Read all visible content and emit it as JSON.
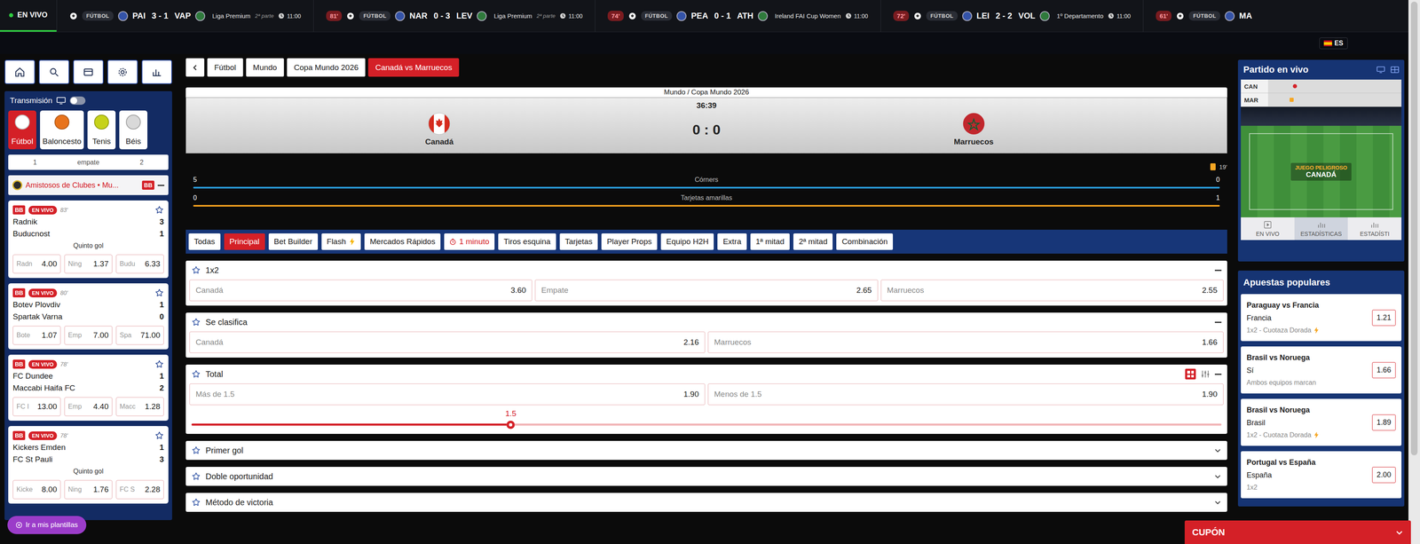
{
  "ticker": {
    "live_label": "EN VIVO",
    "matches": [
      {
        "sport": "FÚTBOL",
        "home": "PAI",
        "score": "3 - 1",
        "away": "VAP",
        "league": "Liga Premium",
        "period": "2ª parte",
        "time": "11:00"
      },
      {
        "minute": "81'",
        "sport": "FÚTBOL",
        "home": "NAR",
        "score": "0 - 3",
        "away": "LEV",
        "league": "Liga Premium",
        "period": "2ª parte",
        "time": "11:00"
      },
      {
        "minute": "74'",
        "sport": "FÚTBOL",
        "home": "PEA",
        "score": "0 - 1",
        "away": "ATH",
        "league": "Ireland FAI Cup Women",
        "time": "11:00"
      },
      {
        "minute": "72'",
        "sport": "FÚTBOL",
        "home": "LEI",
        "score": "2 - 2",
        "away": "VOL",
        "league": "1º Departamento",
        "time": "11:00"
      },
      {
        "minute": "61'",
        "sport": "FÚTBOL",
        "home": "MA"
      }
    ]
  },
  "language": {
    "code": "ES"
  },
  "sidebar": {
    "stream": {
      "label": "Transmisión",
      "on": false
    },
    "sports": [
      {
        "label": "Fútbol",
        "selected": true
      },
      {
        "label": "Baloncesto",
        "selected": false
      },
      {
        "label": "Tenis",
        "selected": false
      },
      {
        "label": "Béis",
        "selected": false
      }
    ],
    "columns": [
      "1",
      "empate",
      "2"
    ],
    "league": {
      "name": "Amistosos de Clubes • Mu...",
      "badge": "BB",
      "expanded": true
    },
    "matches": [
      {
        "badge": "BB",
        "status": "EN VIVO",
        "minute": "83'",
        "favorite": false,
        "teams": [
          {
            "name": "Radnik",
            "score": "3"
          },
          {
            "name": "Buducnost",
            "score": "1"
          }
        ],
        "market": "Quinto gol",
        "odds": [
          {
            "label": "Radn",
            "value": "4.00"
          },
          {
            "label": "Ning",
            "value": "1.37"
          },
          {
            "label": "Budu",
            "value": "6.33"
          }
        ]
      },
      {
        "badge": "BB",
        "status": "EN VIVO",
        "minute": "80'",
        "favorite": false,
        "teams": [
          {
            "name": "Botev Plovdiv",
            "score": "1"
          },
          {
            "name": "Spartak Varna",
            "score": "0"
          }
        ],
        "odds": [
          {
            "label": "Bote",
            "value": "1.07"
          },
          {
            "label": "Emp",
            "value": "7.00"
          },
          {
            "label": "Spa",
            "value": "71.00"
          }
        ]
      },
      {
        "badge": "BB",
        "status": "EN VIVO",
        "minute": "78'",
        "favorite": false,
        "teams": [
          {
            "name": "FC Dundee",
            "score": "1"
          },
          {
            "name": "Maccabi Haifa FC",
            "score": "2"
          }
        ],
        "odds": [
          {
            "label": "FC I",
            "value": "13.00"
          },
          {
            "label": "Emp",
            "value": "4.40"
          },
          {
            "label": "Macc",
            "value": "1.28"
          }
        ]
      },
      {
        "badge": "BB",
        "status": "EN VIVO",
        "minute": "78'",
        "favorite": false,
        "teams": [
          {
            "name": "Kickers Emden",
            "score": "1"
          },
          {
            "name": "FC St Pauli",
            "score": "3"
          }
        ],
        "market": "Quinto gol",
        "odds": [
          {
            "label": "Kicke",
            "value": "8.00"
          },
          {
            "label": "Ning",
            "value": "1.76"
          },
          {
            "label": "FC S",
            "value": "2.28"
          }
        ]
      }
    ],
    "templates_button": "Ir a mis plantillas"
  },
  "breadcrumb": [
    {
      "label": "Fútbol",
      "selected": false
    },
    {
      "label": "Mundo",
      "selected": false
    },
    {
      "label": "Copa Mundo 2026",
      "selected": false
    },
    {
      "label": "Canadá vs Marruecos",
      "selected": true
    }
  ],
  "scoreboard": {
    "path": "Mundo / Copa Mundo 2026",
    "clock": "36:39",
    "home": "Canadá",
    "away": "Marruecos",
    "score": "0 : 0",
    "card_minute": "19'",
    "stats": [
      {
        "label": "Córners",
        "home": "5",
        "away": "0",
        "color": "#2a9fe0"
      },
      {
        "label": "Tarjetas amarillas",
        "home": "0",
        "away": "1",
        "color": "#f2a01e"
      }
    ]
  },
  "market_tabs": [
    {
      "label": "Todas",
      "selected": false,
      "kind": "plain"
    },
    {
      "label": "Principal",
      "selected": true,
      "kind": "plain"
    },
    {
      "label": "Bet Builder",
      "selected": false,
      "kind": "plain"
    },
    {
      "label": "Flash",
      "selected": false,
      "kind": "flash"
    },
    {
      "label": "Mercados Rápidos",
      "selected": false,
      "kind": "plain"
    },
    {
      "label": "1 minuto",
      "selected": false,
      "kind": "timer"
    },
    {
      "label": "Tiros esquina",
      "selected": false,
      "kind": "plain"
    },
    {
      "label": "Tarjetas",
      "selected": false,
      "kind": "plain"
    },
    {
      "label": "Player Props",
      "selected": false,
      "kind": "plain"
    },
    {
      "label": "Equipo H2H",
      "selected": false,
      "kind": "plain"
    },
    {
      "label": "Extra",
      "selected": false,
      "kind": "plain"
    },
    {
      "label": "1ª mitad",
      "selected": false,
      "kind": "plain"
    },
    {
      "label": "2ª mitad",
      "selected": false,
      "kind": "plain"
    },
    {
      "label": "Combinación",
      "selected": false,
      "kind": "plain"
    }
  ],
  "markets": [
    {
      "title": "1x2",
      "kind": "default",
      "expanded": true,
      "favorite": false,
      "outcomes": [
        {
          "label": "Canadá",
          "odds": "3.60"
        },
        {
          "label": "Empate",
          "odds": "2.65"
        },
        {
          "label": "Marruecos",
          "odds": "2.55"
        }
      ]
    },
    {
      "title": "Se clasifica",
      "kind": "default",
      "expanded": true,
      "favorite": false,
      "outcomes": [
        {
          "label": "Canadá",
          "odds": "2.16"
        },
        {
          "label": "Marruecos",
          "odds": "1.66"
        }
      ]
    },
    {
      "title": "Total",
      "kind": "line",
      "expanded": true,
      "favorite": false,
      "outcomes": [
        {
          "label": "Más de 1.5",
          "odds": "1.90"
        },
        {
          "label": "Menos de 1.5",
          "odds": "1.90"
        }
      ],
      "line": {
        "label": "1.5",
        "level": 0.31
      }
    },
    {
      "title": "Primer gol",
      "kind": "default",
      "expanded": false,
      "favorite": false
    },
    {
      "title": "Doble oportunidad",
      "kind": "default",
      "expanded": false,
      "favorite": false
    },
    {
      "title": "Método de victoria",
      "kind": "default",
      "expanded": false,
      "favorite": false
    }
  ],
  "live_panel": {
    "title": "Partido en vivo",
    "timeline": [
      "CAN",
      "MAR"
    ],
    "pitch": {
      "event": "JUEGO PELIGROSO",
      "team": "CANADÁ"
    },
    "tabs": [
      {
        "label": "EN VIVO",
        "selected": false
      },
      {
        "label": "ESTADÍSTICAS",
        "selected": true
      },
      {
        "label": "ESTADÍSTI",
        "selected": false
      }
    ]
  },
  "popular": {
    "title": "Apuestas populares",
    "bets": [
      {
        "match": "Paraguay vs Francia",
        "pick": "Francia",
        "market": "1x2 - Cuotaza Dorada",
        "boost": true,
        "odds": "1.21"
      },
      {
        "match": "Brasil vs Noruega",
        "pick": "Sí",
        "market": "Ambos equipos marcan",
        "boost": false,
        "odds": "1.66"
      },
      {
        "match": "Brasil vs Noruega",
        "pick": "Brasil",
        "market": "1x2 - Cuotaza Dorada",
        "boost": true,
        "odds": "1.89"
      },
      {
        "match": "Portugal vs España",
        "pick": "España",
        "market": "1x2",
        "boost": false,
        "odds": "2.00"
      }
    ]
  },
  "coupon": {
    "label": "CUPÓN",
    "expanded": false
  }
}
